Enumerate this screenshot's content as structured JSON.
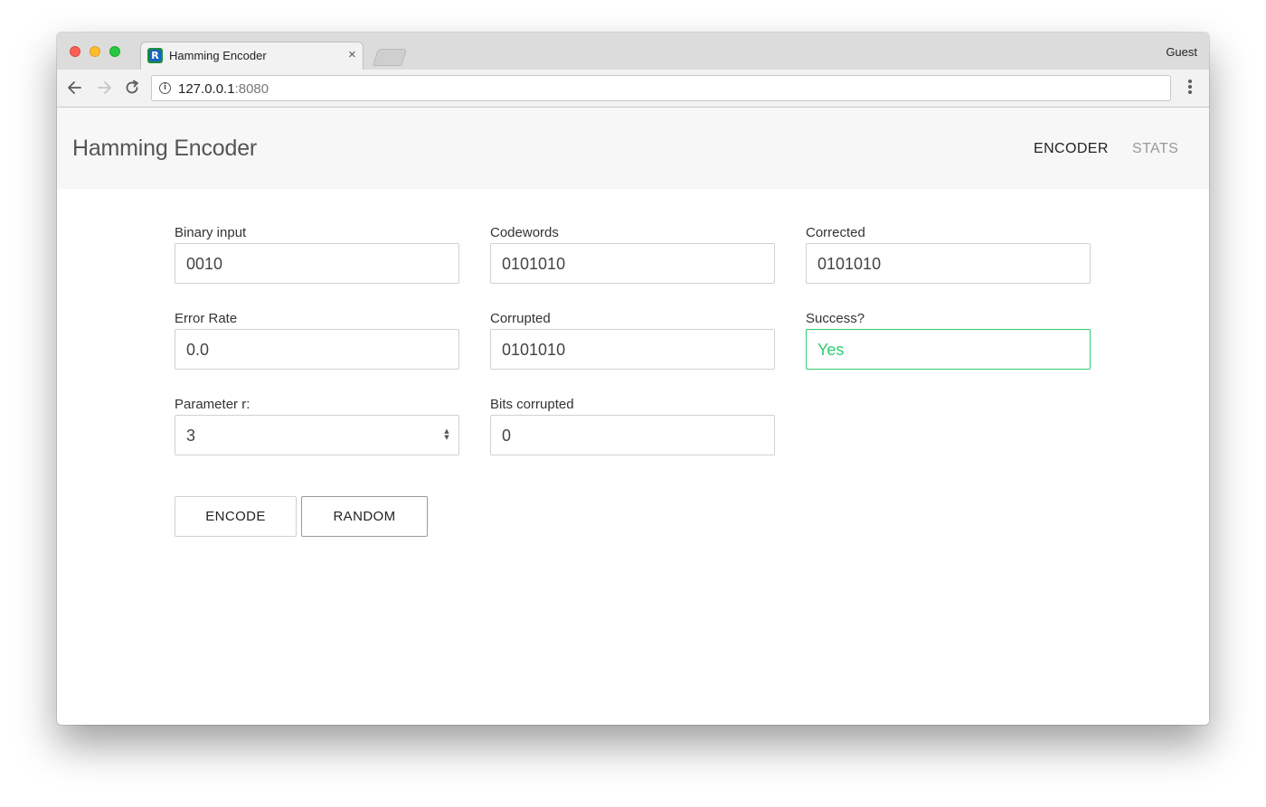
{
  "browser": {
    "tab_title": "Hamming Encoder",
    "tab_close": "×",
    "favicon_letter": "R",
    "profile": "Guest",
    "url_host": "127.0.0.1",
    "url_port": ":8080",
    "back_icon": "arrow-left",
    "forward_icon": "arrow-right",
    "reload_icon": "reload",
    "info_icon": "info-circle",
    "menu_icon": "vertical-ellipsis"
  },
  "app": {
    "brand": "Hamming Encoder",
    "nav": {
      "encoder": "ENCODER",
      "stats": "STATS"
    },
    "accent_color": "#2ecc71"
  },
  "form": {
    "binary_input": {
      "label": "Binary input",
      "value": "0010"
    },
    "codewords": {
      "label": "Codewords",
      "value": "0101010"
    },
    "corrected": {
      "label": "Corrected",
      "value": "0101010"
    },
    "error_rate": {
      "label": "Error Rate",
      "value": "0.0"
    },
    "corrupted": {
      "label": "Corrupted",
      "value": "0101010"
    },
    "success": {
      "label": "Success?",
      "value": "Yes"
    },
    "parameter_r": {
      "label": "Parameter r:",
      "value": "3"
    },
    "bits_corrupted": {
      "label": "Bits corrupted",
      "value": "0"
    }
  },
  "buttons": {
    "encode": "ENCODE",
    "random": "RANDOM"
  }
}
